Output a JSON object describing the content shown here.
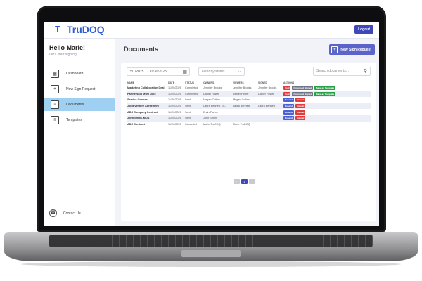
{
  "app": {
    "logo_mark": "T",
    "logo_text": "TruDOQ",
    "logout_label": "Logout"
  },
  "sidebar": {
    "greeting": "Hello Marie!",
    "subtitle": "Let's start signing",
    "items": [
      {
        "label": "Dashboard",
        "icon": "dashboard-icon"
      },
      {
        "label": "New Sign Request",
        "icon": "new-document-icon"
      },
      {
        "label": "Documents",
        "icon": "documents-icon",
        "active": true
      },
      {
        "label": "Templates",
        "icon": "templates-icon"
      }
    ],
    "contact_label": "Contact Us"
  },
  "main": {
    "title": "Documents",
    "new_sign_label": "New Sign Request",
    "filters": {
      "date_range": "5/1/2025 → 11/30/2025",
      "status_placeholder": "Filter by status",
      "search_placeholder": "Search documents..."
    },
    "table": {
      "headers": [
        "NAME",
        "DATE",
        "STATUS",
        "OWNERS",
        "VIEWERS",
        "SIGNED",
        "ACTIONS"
      ],
      "rows": [
        {
          "name": "Marketing Collaboration Deal",
          "date": "11/20/2025",
          "status": "Completed",
          "owners": "Jennifer Brooks",
          "viewers": "Jennifer Brooks",
          "signed": "Jennifer Brooks",
          "actions": [
            "void",
            "download",
            "template"
          ]
        },
        {
          "name": "Partnership MOU 2025",
          "date": "11/20/2025",
          "status": "Completed",
          "owners": "Daniel Foster",
          "viewers": "Daniel Foster",
          "signed": "Daniel Foster",
          "actions": [
            "void",
            "download",
            "template"
          ]
        },
        {
          "name": "Service Contract",
          "date": "11/20/2025",
          "status": "Sent",
          "owners": "Megan Collins",
          "viewers": "Megan Collins",
          "signed": "",
          "actions": [
            "resend",
            "cancel"
          ]
        },
        {
          "name": "Joint Venture Agreement",
          "date": "11/20/2025",
          "status": "Sent",
          "owners": "Laura Bennett, Th...",
          "viewers": "Laura Bennett",
          "signed": "Laura Bennett",
          "actions": [
            "resend",
            "cancel"
          ]
        },
        {
          "name": "ABC Company Contract",
          "date": "11/20/2025",
          "status": "Sent",
          "owners": "Ervin Parker",
          "viewers": "",
          "signed": "",
          "actions": [
            "resend",
            "cancel"
          ]
        },
        {
          "name": "John Smith, MDA",
          "date": "11/20/2025",
          "status": "Sent",
          "owners": "John Smith",
          "viewers": "",
          "signed": "",
          "actions": [
            "resend",
            "cancel"
          ]
        },
        {
          "name": "ABC Contract",
          "date": "11/20/2025",
          "status": "Cancelled",
          "owners": "Marie TruDOQ",
          "viewers": "Marie TruDOQ",
          "signed": "",
          "actions": []
        }
      ]
    },
    "actions": {
      "void": "Void",
      "download": "Download Signed",
      "template": "Save as Template",
      "resend": "Resend",
      "cancel": "Cancel"
    },
    "pagination": {
      "prev": "‹",
      "current": "1",
      "next": "›"
    }
  },
  "colors": {
    "brand": "#2f5bd3",
    "accent": "#3f48b8",
    "active_nav": "#9fd0f1",
    "danger": "#e23b3b",
    "success": "#27a046"
  }
}
